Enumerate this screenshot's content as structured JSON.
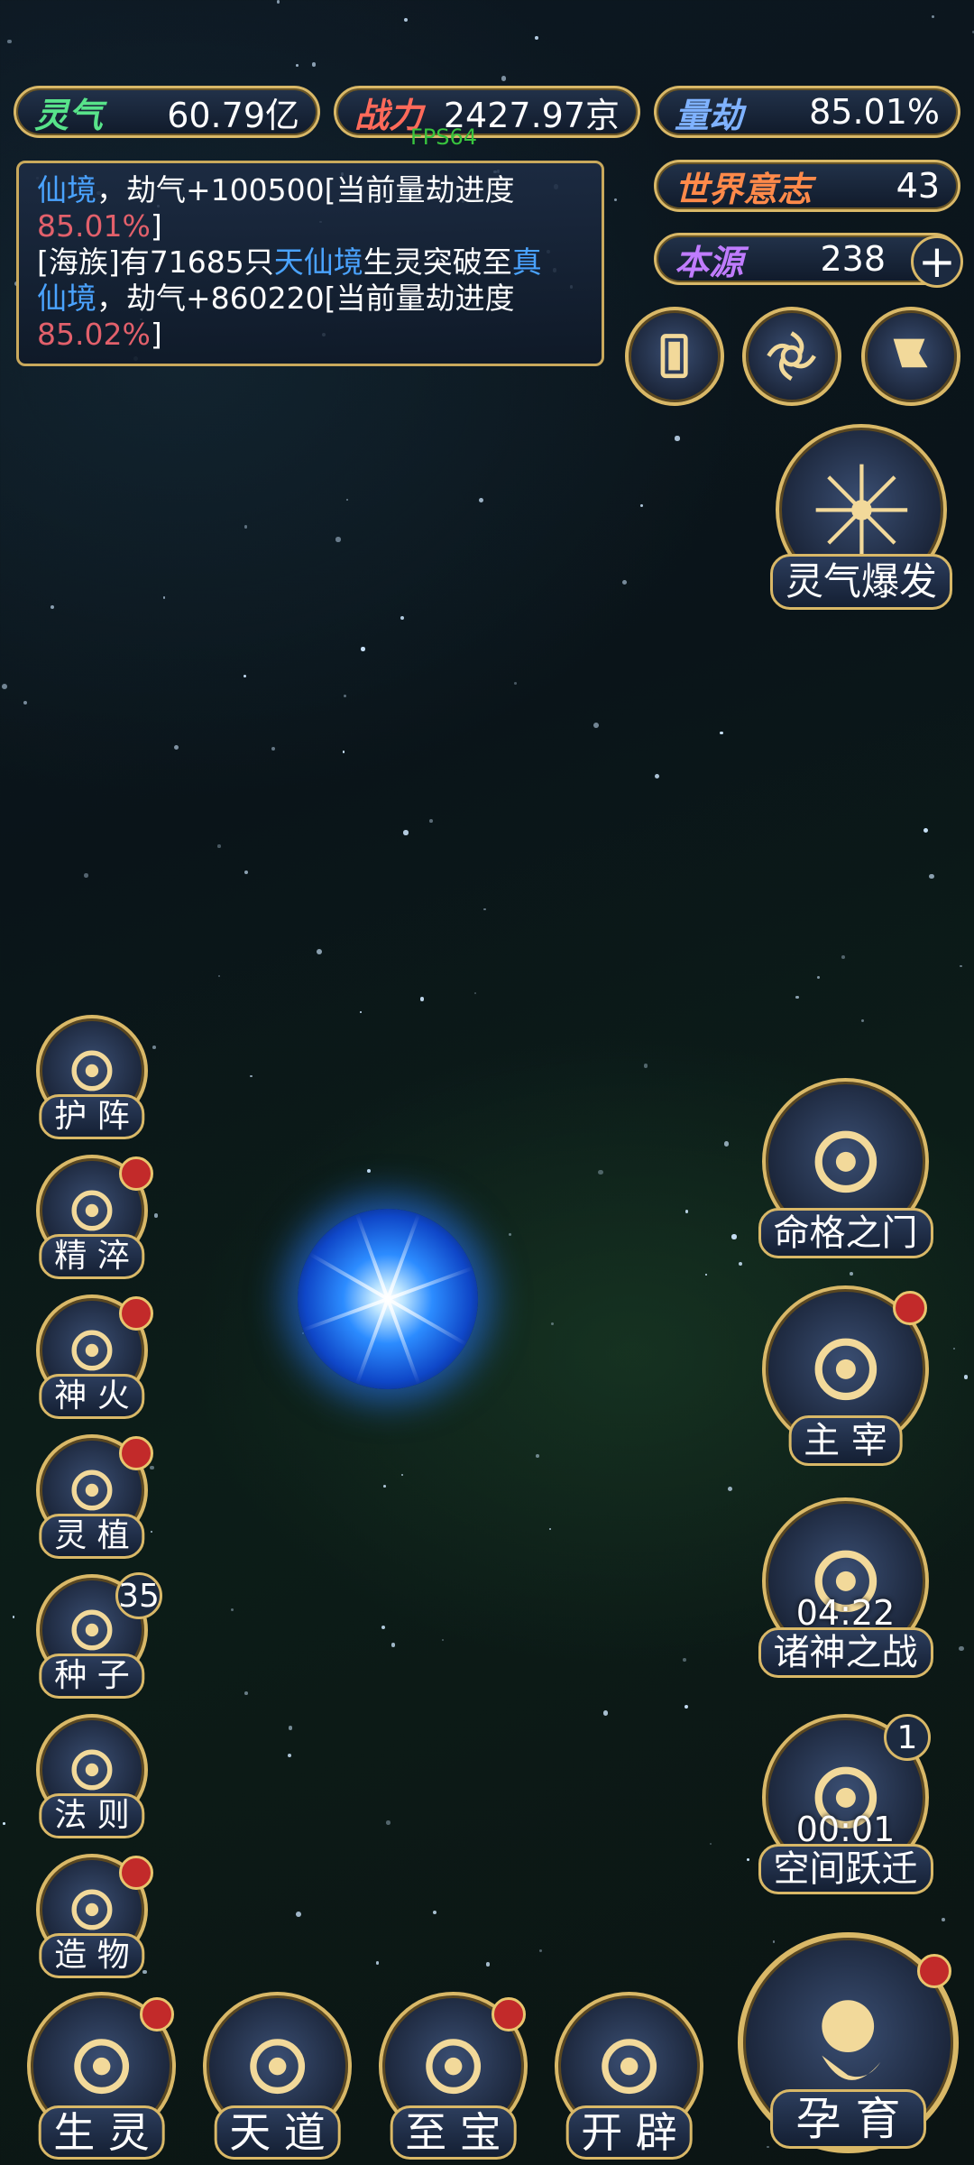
{
  "top_stats": {
    "lingqi": {
      "label": "灵气",
      "value": "60.79亿",
      "color": "#58e38a"
    },
    "zhanli": {
      "label": "战力",
      "value": "2427.97京",
      "color": "#ff6a5a"
    },
    "liangjie": {
      "label": "量劫",
      "value": "85.01%",
      "color": "#7fb2ff"
    },
    "shijie": {
      "label": "世界意志",
      "value": "43",
      "color": "#ff8a4a"
    },
    "benyuan": {
      "label": "本源",
      "value": "238",
      "color": "#c07cff"
    }
  },
  "fps": "FPS64",
  "log": {
    "line1_a": "仙境",
    "line1_b": "，劫气+100500[当前量劫进度",
    "line1_c": "85.01%",
    "line1_d": "]",
    "line2_a": "[海族]有71685只",
    "line2_b": "天仙境",
    "line2_c": "生灵突破至",
    "line2_d": "真",
    "line3_a": "仙境",
    "line3_b": "，劫气+860220[当前量劫进度",
    "line4_a": "85.02%",
    "line4_b": "]"
  },
  "top_icons": [
    "card-icon",
    "vortex-icon",
    "flag-icon"
  ],
  "burst": {
    "label": "灵气爆发"
  },
  "left_menu": [
    {
      "label": "护 阵",
      "icon": "yinyang-icon",
      "red_dot": false
    },
    {
      "label": "精 淬",
      "icon": "lotus-flame-icon",
      "red_dot": true
    },
    {
      "label": "神 火",
      "icon": "fire-icon",
      "red_dot": true
    },
    {
      "label": "灵 植",
      "icon": "plant-icon",
      "red_dot": true
    },
    {
      "label": "种 子",
      "icon": "seed-icon",
      "badge": "35"
    },
    {
      "label": "法 则",
      "icon": "rune-icon",
      "red_dot": false
    },
    {
      "label": "造 物",
      "icon": "diamond-icon",
      "red_dot": true
    }
  ],
  "right_menu": [
    {
      "label": "命格之门",
      "icon": "gate-icon"
    },
    {
      "label": "主 宰",
      "icon": "dragon-icon",
      "red_dot": true
    },
    {
      "label": "诸神之战",
      "icon": "sword-icon",
      "timer": "04:22"
    },
    {
      "label": "空间跃迁",
      "icon": "portal-icon",
      "timer": "00:01",
      "badge": "1"
    }
  ],
  "bottom_menu": [
    {
      "label": "生 灵",
      "icon": "phoenix-icon",
      "red_dot": true
    },
    {
      "label": "天 道",
      "icon": "wave-icon",
      "red_dot": false
    },
    {
      "label": "至 宝",
      "icon": "treasure-icon",
      "red_dot": true
    },
    {
      "label": "开 辟",
      "icon": "axe-icon",
      "red_dot": false
    }
  ],
  "main_button": {
    "label": "孕 育",
    "icon": "embryo-icon"
  }
}
